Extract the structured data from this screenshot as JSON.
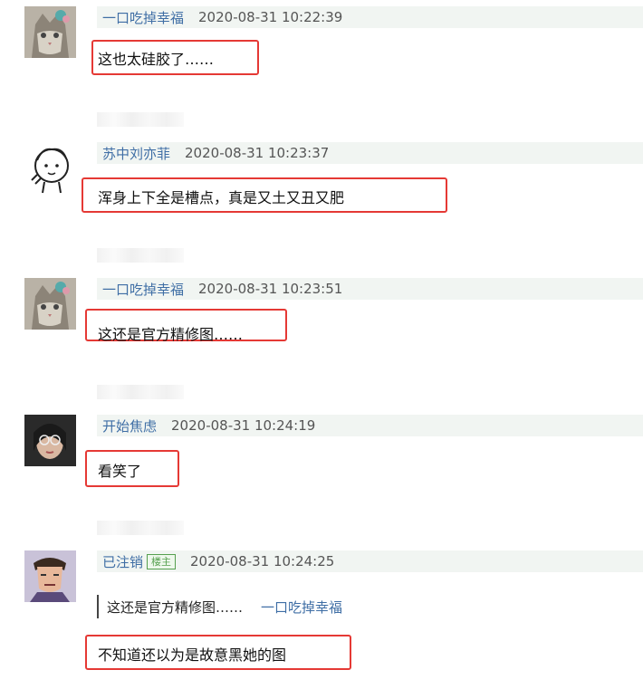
{
  "comments": [
    {
      "username": "一口吃掉幸福",
      "timestamp": "2020-08-31 10:22:39",
      "text": "这也太硅胶了……"
    },
    {
      "username": "苏中刘亦菲",
      "timestamp": "2020-08-31 10:23:37",
      "text": "浑身上下全是槽点，真是又土又丑又肥"
    },
    {
      "username": "一口吃掉幸福",
      "timestamp": "2020-08-31 10:23:51",
      "text": "这还是官方精修图……"
    },
    {
      "username": "开始焦虑",
      "timestamp": "2020-08-31 10:24:19",
      "text": "看笑了"
    },
    {
      "username": "已注销",
      "badge": "楼主",
      "timestamp": "2020-08-31 10:24:25",
      "quote": {
        "text": "这还是官方精修图……",
        "user": "一口吃掉幸福"
      },
      "text": "不知道还以为是故意黑她的图"
    }
  ],
  "colors": {
    "highlight_border": "#e53935",
    "username": "#3f6ea5",
    "header_bg": "#f1f5f2",
    "badge": "#56a04f"
  }
}
